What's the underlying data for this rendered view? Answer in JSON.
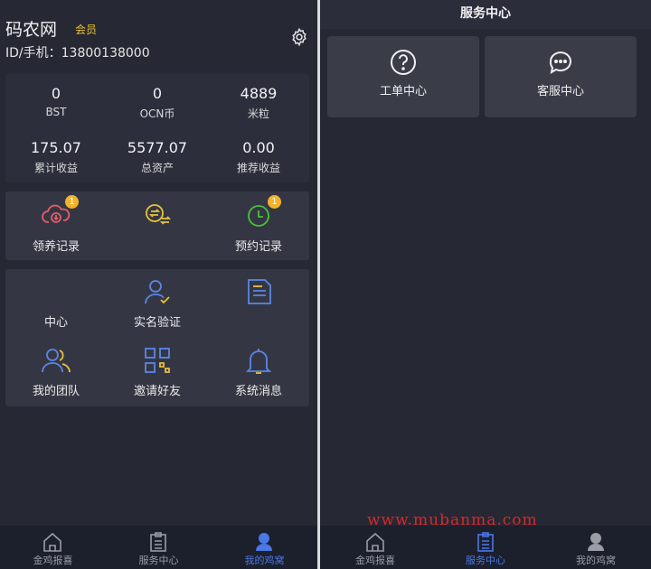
{
  "left": {
    "header": {
      "app_name": "码农网",
      "badge": "会员",
      "uid": "ID/手机：13800138000",
      "settings_icon": "gear-icon"
    },
    "stats": [
      {
        "value": "0",
        "label": "BST"
      },
      {
        "value": "0",
        "label": "OCN币"
      },
      {
        "value": "4889",
        "label": "米粒"
      },
      {
        "value": "175.07",
        "label": "累计收益"
      },
      {
        "value": "5577.07",
        "label": "总资产"
      },
      {
        "value": "0.00",
        "label": "推荐收益"
      }
    ],
    "records": [
      {
        "label": "领养记录",
        "badge": "1",
        "icon": "cloud-download-icon"
      },
      {
        "label": "",
        "badge": "",
        "icon": "exchange-icon"
      },
      {
        "label": "预约记录",
        "badge": "1",
        "icon": "clock-icon"
      }
    ],
    "grid": [
      {
        "label": "中心",
        "icon": ""
      },
      {
        "label": "实名验证",
        "icon": "user-check-icon"
      },
      {
        "label": "",
        "icon": "document-icon"
      },
      {
        "label": "我的团队",
        "icon": "team-icon"
      },
      {
        "label": "邀请好友",
        "icon": "qrcode-icon"
      },
      {
        "label": "系统消息",
        "icon": "bell-icon"
      }
    ]
  },
  "tabbar": [
    {
      "label": "金鸡报喜",
      "icon": "home-icon"
    },
    {
      "label": "服务中心",
      "icon": "clipboard-icon"
    },
    {
      "label": "我的鸡窝",
      "icon": "user-icon"
    }
  ],
  "right": {
    "title": "服务中心",
    "services": [
      {
        "label": "工单中心",
        "icon": "question-icon"
      },
      {
        "label": "客服中心",
        "icon": "chat-icon"
      }
    ]
  },
  "watermark": "www.mubanma.com",
  "colors": {
    "accent": "#4a78e6",
    "gold": "#e8c23a",
    "badge": "#f1b32b",
    "red": "#e25d6b",
    "green": "#49c23b"
  }
}
